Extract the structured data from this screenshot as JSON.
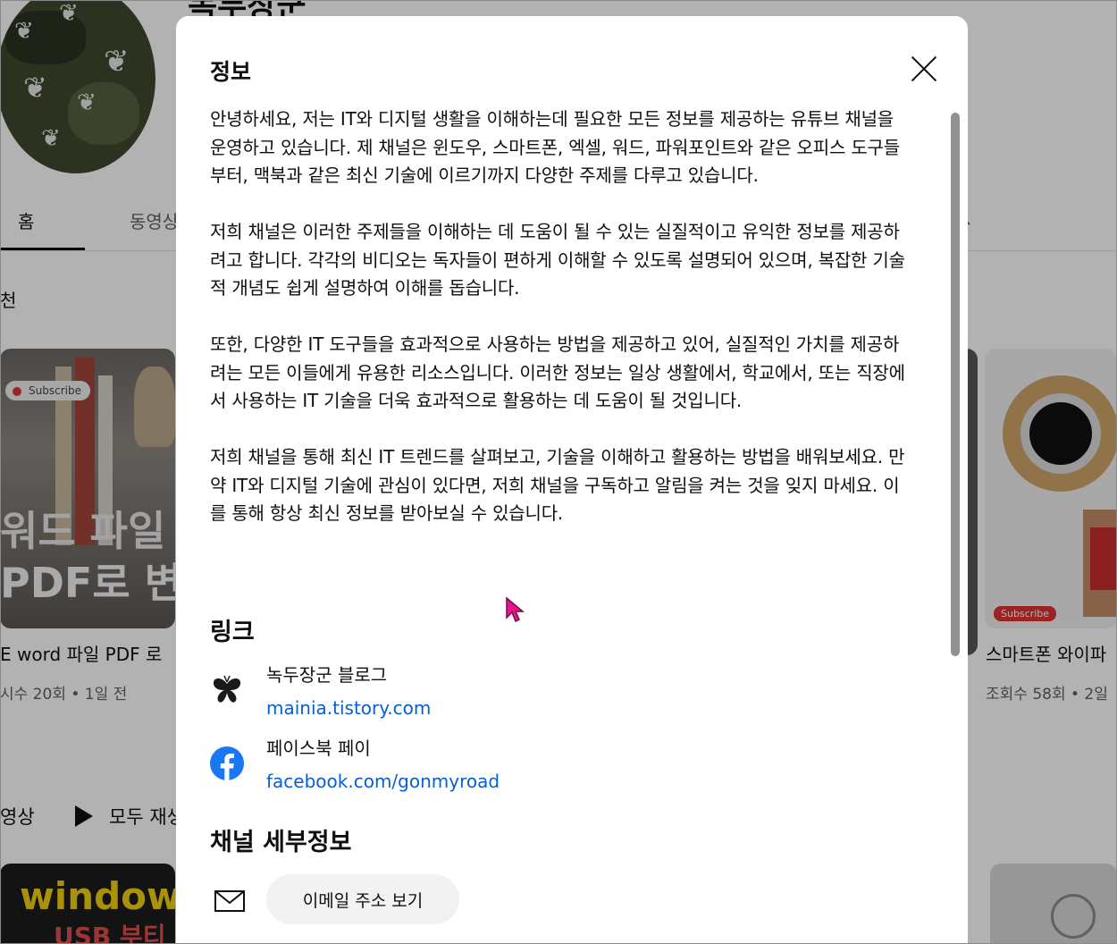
{
  "background": {
    "channel_title": "녹두장군",
    "tabs": [
      "홈",
      "동영상"
    ],
    "section_label": "천",
    "thumbnail_left": {
      "badge": "Subscribe",
      "line1": "워드 파일",
      "line2": "PDF로 변"
    },
    "thumbnail_right": {
      "badge": "Subscribe"
    },
    "video_left": {
      "title": "E word 파일 PDF 로",
      "meta": "시수 20회 • 1일 전"
    },
    "video_right": {
      "title": "스마트폰 와이파",
      "meta": "조회수 58회 • 2일"
    },
    "row2": {
      "label": "영상",
      "play_all": "모두 재생"
    },
    "thumbnail_bottom_left": {
      "line1": "window",
      "line2": "USB 부티"
    }
  },
  "dialog": {
    "title": "정보",
    "description": [
      "안녕하세요, 저는 IT와 디지털 생활을 이해하는데 필요한 모든 정보를 제공하는 유튜브 채널을 운영하고 있습니다. 제 채널은 윈도우, 스마트폰, 엑셀, 워드, 파워포인트와 같은 오피스 도구들부터, 맥북과 같은 최신 기술에 이르기까지 다양한 주제를 다루고 있습니다.",
      "저희 채널은 이러한 주제들을 이해하는 데 도움이 될 수 있는 실질적이고 유익한 정보를 제공하려고 합니다. 각각의 비디오는 독자들이 편하게 이해할 수 있도록 설명되어 있으며, 복잡한 기술적 개념도 쉽게 설명하여 이해를 돕습니다.",
      "또한, 다양한 IT 도구들을 효과적으로 사용하는 방법을 제공하고 있어, 실질적인 가치를 제공하려는 모든 이들에게 유용한 리소스입니다. 이러한 정보는 일상 생활에서, 학교에서, 또는 직장에서 사용하는 IT 기술을 더욱 효과적으로 활용하는 데 도움이 될 것입니다.",
      "저희 채널을 통해 최신 IT 트렌드를 살펴보고, 기술을 이해하고 활용하는 방법을 배워보세요. 만약 IT와 디지털 기술에 관심이 있다면, 저희 채널을 구독하고 알림을 켜는 것을 잊지 마세요. 이를 통해 항상 최신 정보를 받아보실 수 있습니다."
    ],
    "links_title": "링크",
    "links": [
      {
        "name": "녹두장군 블로그",
        "url": "mainia.tistory.com",
        "icon": "butterfly-icon"
      },
      {
        "name": "페이스북 페이",
        "url": "facebook.com/gonmyroad",
        "icon": "facebook-icon"
      }
    ],
    "details_title": "채널 세부정보",
    "email_button": "이메일 주소 보기",
    "colors": {
      "link": "#065fd4",
      "facebook": "#1877f2",
      "overlay": "rgba(0,0,0,0.30)"
    }
  }
}
